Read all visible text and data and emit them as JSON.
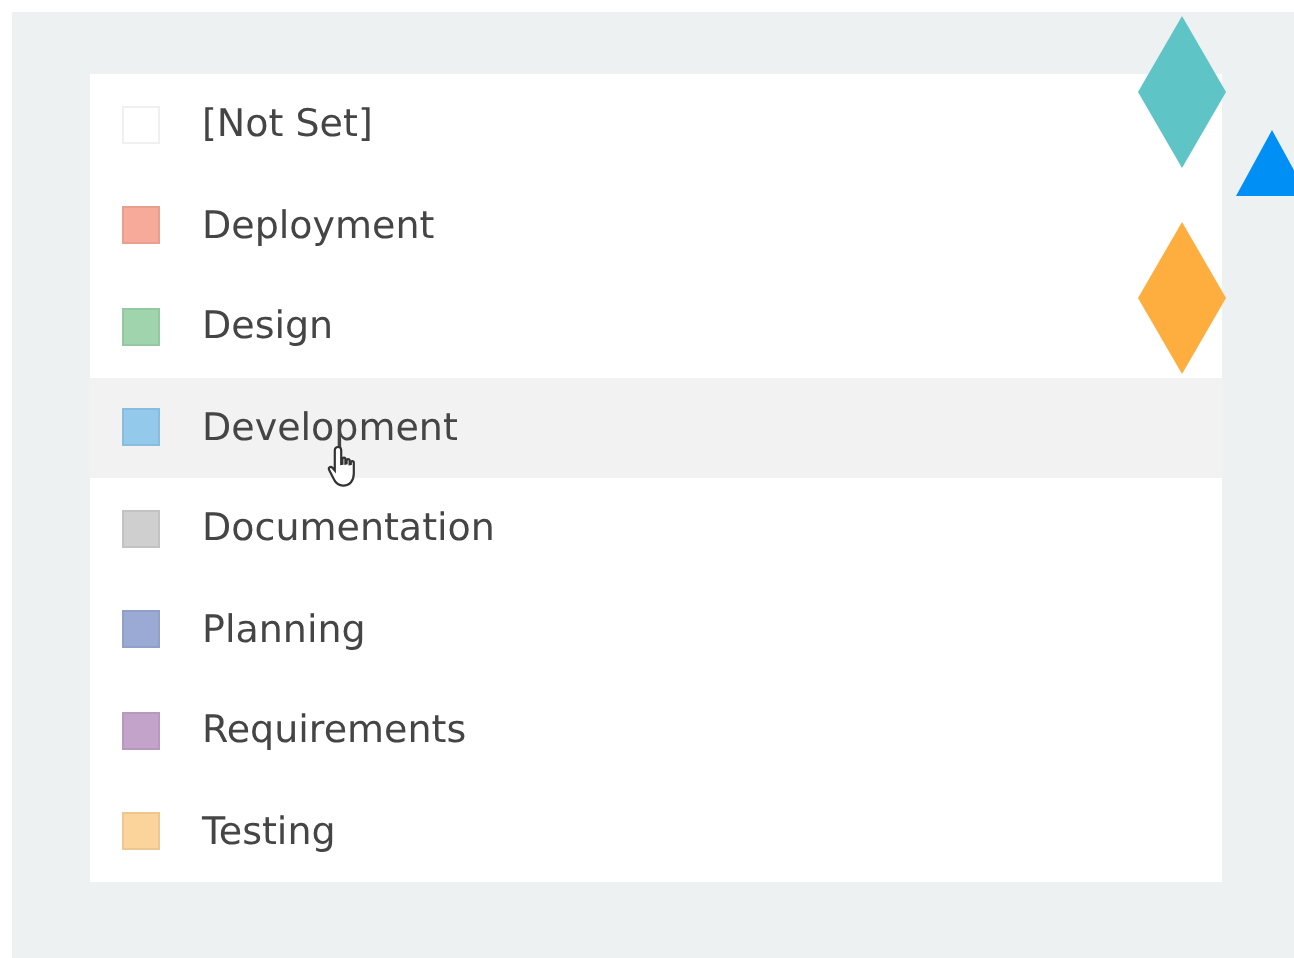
{
  "options": [
    {
      "label": "[Not Set]",
      "color": "#ffffff",
      "hovered": false
    },
    {
      "label": "Deployment",
      "color": "#f7a99a",
      "hovered": false
    },
    {
      "label": "Design",
      "color": "#9fd4ad",
      "hovered": false
    },
    {
      "label": "Development",
      "color": "#93c9eb",
      "hovered": true
    },
    {
      "label": "Documentation",
      "color": "#cfcfcf",
      "hovered": false
    },
    {
      "label": "Planning",
      "color": "#9aaad4",
      "hovered": false
    },
    {
      "label": "Requirements",
      "color": "#c3a3c9",
      "hovered": false
    },
    {
      "label": "Testing",
      "color": "#fbd49b",
      "hovered": false
    }
  ]
}
